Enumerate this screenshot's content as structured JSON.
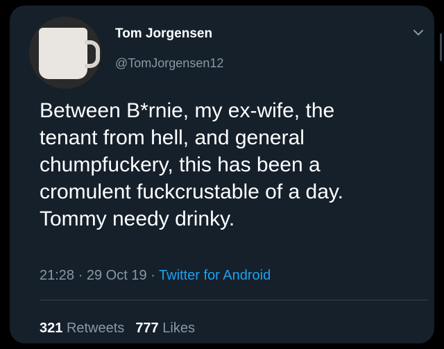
{
  "colors": {
    "background": "#15202b",
    "text": "#ffffff",
    "muted": "#8899a6",
    "link": "#1da1f2"
  },
  "author": {
    "name": "Tom Jorgensen",
    "handle": "@TomJorgensen12",
    "avatar_icon": "mug-avatar-icon"
  },
  "tweet": {
    "text": "Between B*rnie, my ex-wife, the\ntenant from hell, and general\nchumpfuckery, this has been a\ncromulent fuckcrustable of a day.\nTommy needy drinky.",
    "time": "21:28",
    "separator": "·",
    "date": "29 Oct 19",
    "source": "Twitter for Android"
  },
  "stats": {
    "retweets_count": "321",
    "retweets_label": "Retweets",
    "likes_count": "777",
    "likes_label": "Likes"
  },
  "menu_icon": "chevron-down-icon"
}
